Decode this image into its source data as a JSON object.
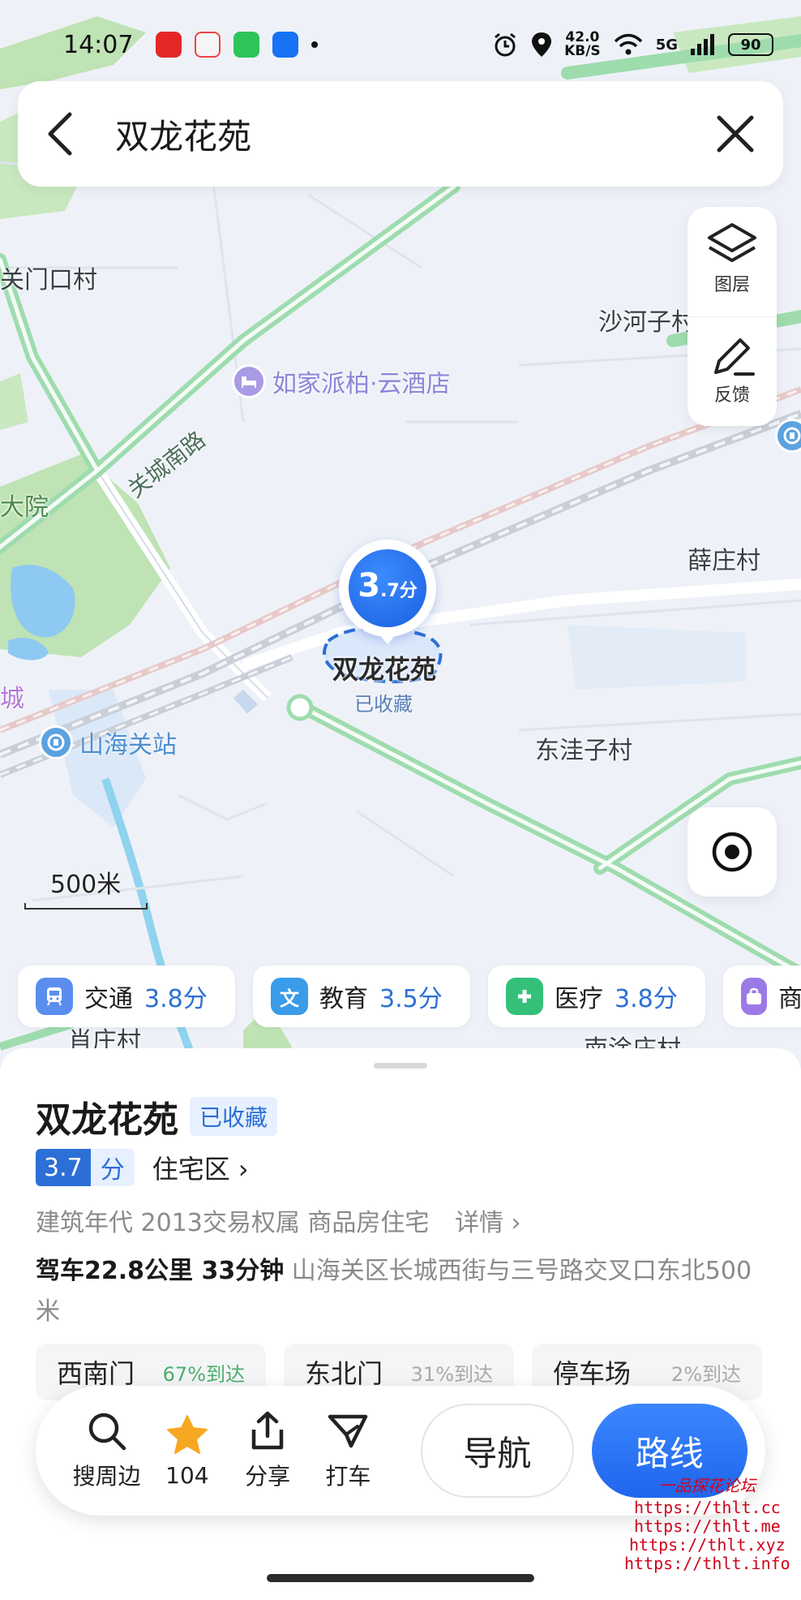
{
  "status_bar": {
    "time": "14:07",
    "speed_value": "42.0",
    "speed_unit": "KB/S",
    "network": "5G",
    "battery": "90",
    "icons": [
      "alarm-icon",
      "location-icon",
      "wifi-icon",
      "signal-icon",
      "battery-icon"
    ]
  },
  "search": {
    "query": "双龙花苑"
  },
  "tools": {
    "layers_label": "图层",
    "feedback_label": "反馈"
  },
  "map": {
    "labels": {
      "guanmenkou": "关门口村",
      "shahezi": "沙河子村",
      "xuezhuang": "薛庄村",
      "dongwazi": "东洼子村",
      "dayuan": "大院",
      "cheng": "城",
      "xiaozhuang": "肖庄村",
      "nantuzhuang": "南涂庄村",
      "road_guancheng": "关城南路"
    },
    "pois": {
      "hotel": "如家派柏·云酒店",
      "station": "山海关站"
    },
    "marker": {
      "score_big": "3",
      "score_small": ".7分",
      "place_name": "双龙花苑",
      "fav_label": "已收藏"
    },
    "scale": "500米"
  },
  "chips": [
    {
      "label": "交通",
      "score": "3.8分",
      "color": "#5b8def",
      "icon": "bus-icon"
    },
    {
      "label": "教育",
      "score": "3.5分",
      "color": "#3a9be8",
      "icon": "education-icon"
    },
    {
      "label": "医疗",
      "score": "3.8分",
      "color": "#35c07a",
      "icon": "medical-icon"
    },
    {
      "label": "商",
      "score": "",
      "color": "#9c7ae6",
      "icon": "shopping-icon"
    }
  ],
  "sheet": {
    "title": "双龙花苑",
    "fav_badge": "已收藏",
    "score_value": "3.7",
    "score_unit": "分",
    "type": "住宅区",
    "info": "建筑年代 2013交易权属 商品房住宅",
    "detail": "详情",
    "drive": "驾车22.8公里 33分钟",
    "address": "山海关区长城西街与三号路交叉口东北500米",
    "gates": [
      {
        "name": "西南门",
        "pct": "67%到达"
      },
      {
        "name": "东北门",
        "pct": "31%到达"
      },
      {
        "name": "停车场",
        "pct": "2%到达"
      }
    ]
  },
  "actions": {
    "nearby": "搜周边",
    "favorites_count": "104",
    "share": "分享",
    "taxi": "打车",
    "navigate": "导航",
    "route": "路线"
  },
  "watermark": {
    "title": "一品探花论坛",
    "urls": [
      "https://thlt.cc",
      "https://thlt.me",
      "https://thlt.xyz",
      "https://thlt.info"
    ]
  },
  "colors": {
    "accent": "#2c6fd6",
    "route_btn": "#1f66ec",
    "map_bg": "#eef2f8",
    "green_area": "#bfe3b4",
    "water": "#8ec9f2",
    "road_green": "#9edcae"
  }
}
